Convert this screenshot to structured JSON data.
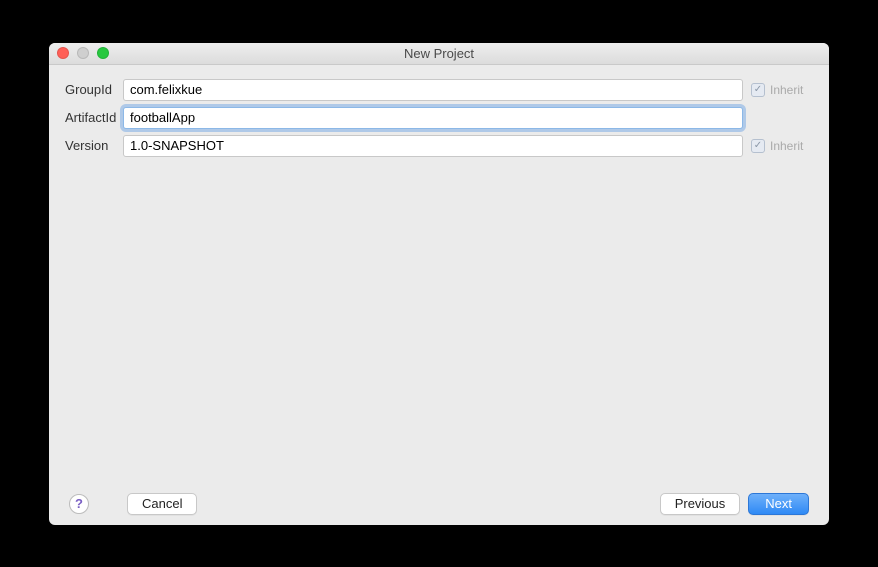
{
  "window": {
    "title": "New Project"
  },
  "form": {
    "groupIdLabel": "GroupId",
    "groupIdValue": "com.felixkue",
    "artifactIdLabel": "ArtifactId",
    "artifactIdValue": "footballApp",
    "versionLabel": "Version",
    "versionValue": "1.0-SNAPSHOT",
    "inheritLabel": "Inherit"
  },
  "footer": {
    "helpSymbol": "?",
    "cancel": "Cancel",
    "previous": "Previous",
    "next": "Next"
  }
}
